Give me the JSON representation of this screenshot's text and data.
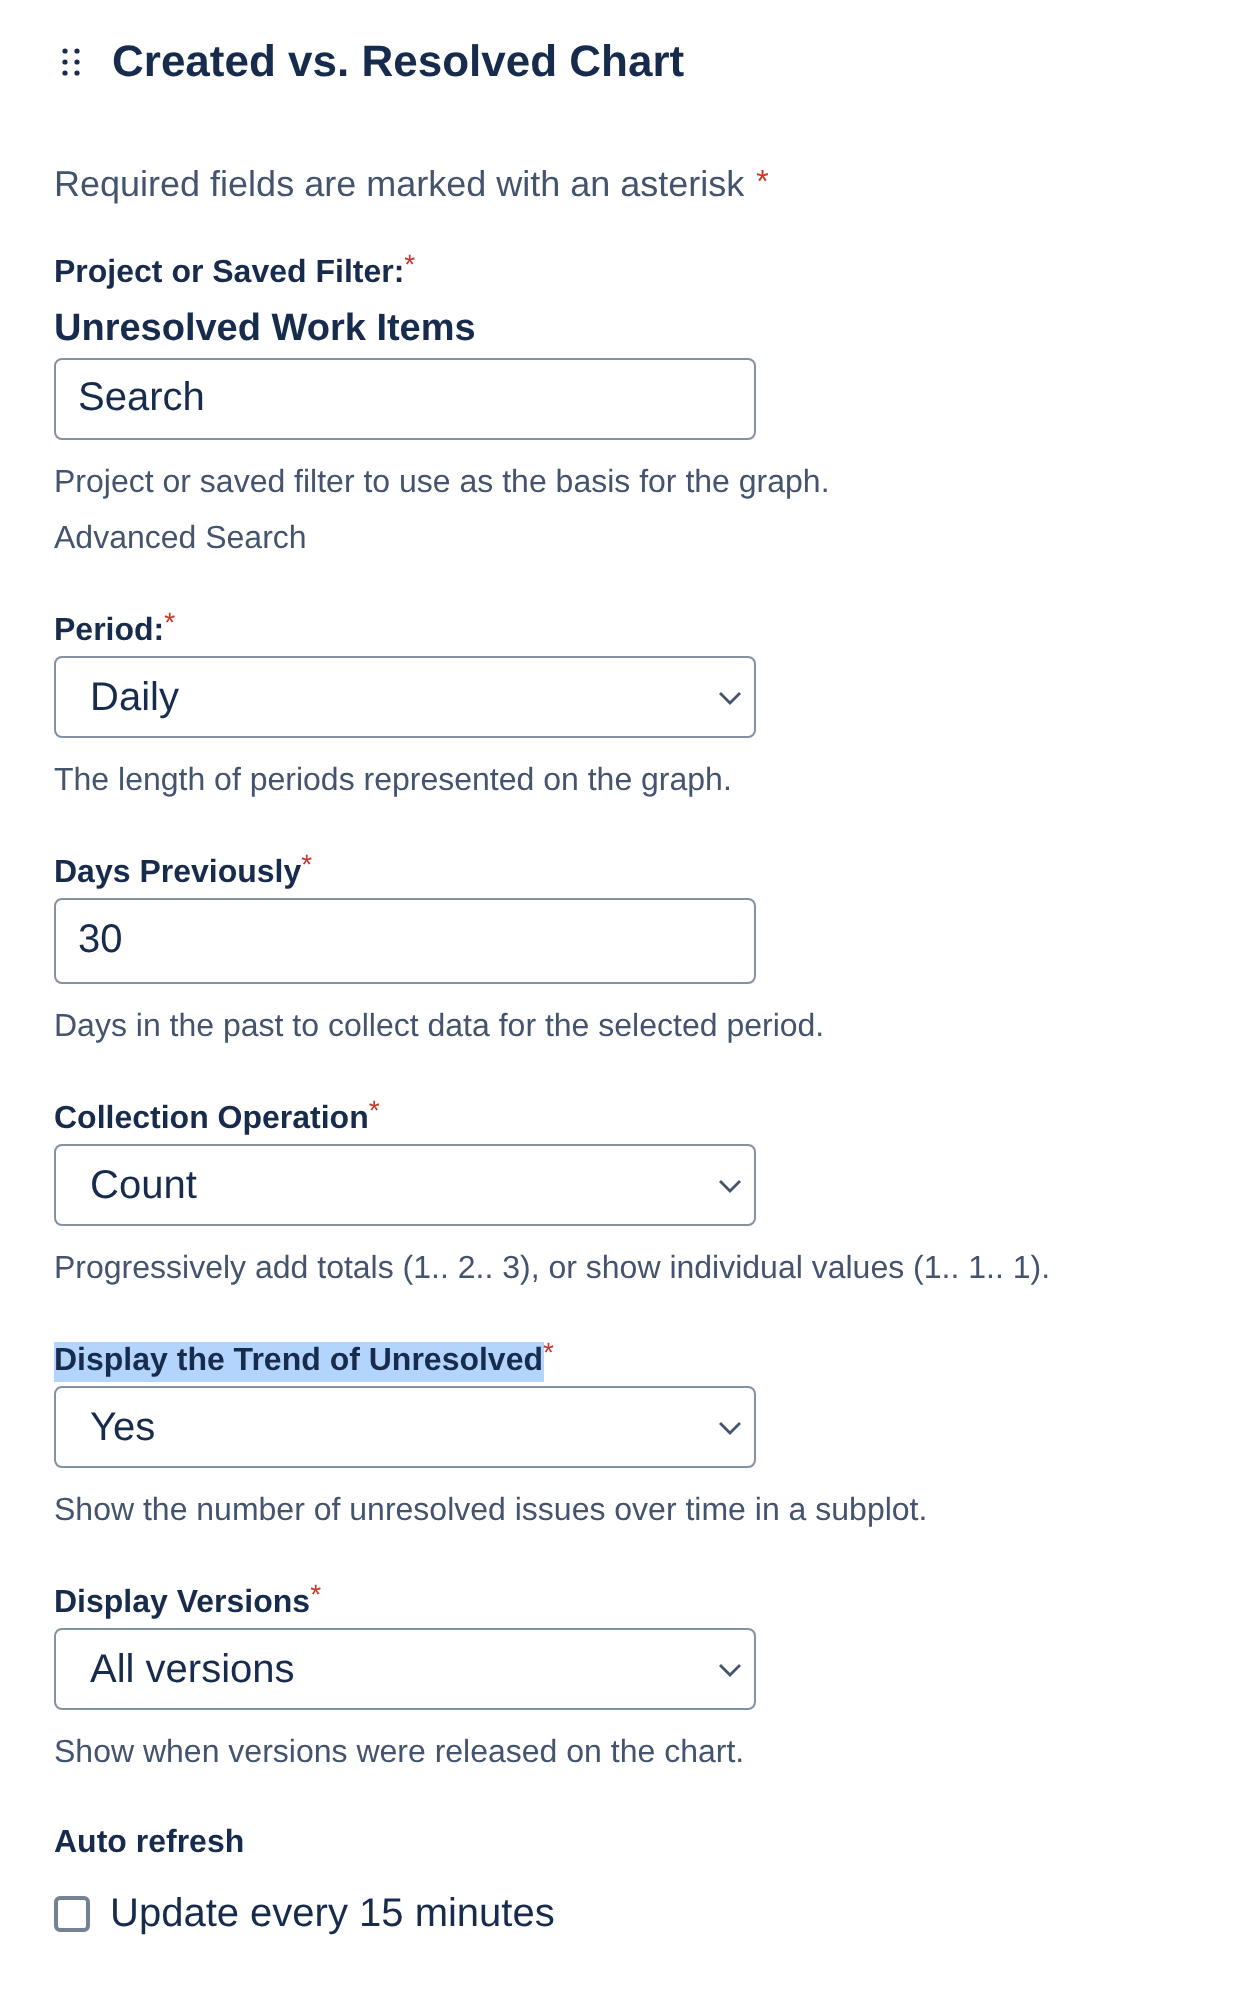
{
  "title": "Created vs. Resolved Chart",
  "required_note": {
    "text": "Required fields are marked with an asterisk",
    "mark": "*"
  },
  "fields": [
    {
      "kind": "filter",
      "label": "Project or Saved Filter:",
      "required_mark": "*",
      "highlighted": false,
      "current": "Unresolved Work Items",
      "placeholder": "Search",
      "help": "Project or saved filter to use as the basis for the graph.",
      "link": "Advanced Search"
    },
    {
      "kind": "select",
      "label": "Period:",
      "required_mark": "*",
      "highlighted": false,
      "value": "Daily",
      "help": "The length of periods represented on the graph."
    },
    {
      "kind": "text",
      "label": "Days Previously",
      "required_mark": "*",
      "highlighted": false,
      "value": "30",
      "help": "Days in the past to collect data for the selected period."
    },
    {
      "kind": "select",
      "label": "Collection Operation",
      "required_mark": "*",
      "highlighted": false,
      "value": "Count",
      "help": "Progressively add totals (1.. 2.. 3), or show individual values (1.. 1.. 1)."
    },
    {
      "kind": "select",
      "label": "Display the Trend of Unresolved",
      "required_mark": "*",
      "highlighted": true,
      "value": "Yes",
      "help": "Show the number of unresolved issues over time in a subplot."
    },
    {
      "kind": "select",
      "label": "Display Versions",
      "required_mark": "*",
      "highlighted": false,
      "value": "All versions",
      "help": "Show when versions were released on the chart."
    },
    {
      "kind": "checkbox",
      "label": "Auto refresh",
      "highlighted": false,
      "option": "Update every 15 minutes",
      "checked": false
    }
  ]
}
